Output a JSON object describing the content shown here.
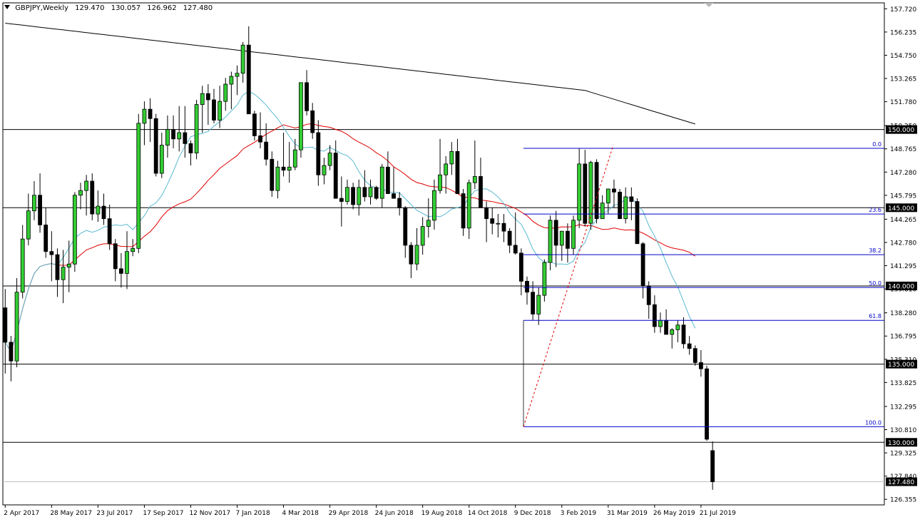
{
  "header": {
    "symbol": "GBPJPY,Weekly",
    "ohlc": [
      "129.470",
      "130.057",
      "126.962",
      "127.480"
    ]
  },
  "chart_data": {
    "type": "candlestick",
    "symbol": "GBPJPY",
    "timeframe": "Weekly",
    "ylim": [
      126.0,
      158.1
    ],
    "y_ticks": [
      "157.720",
      "156.235",
      "154.750",
      "153.265",
      "151.780",
      "150.250",
      "148.765",
      "147.280",
      "145.795",
      "144.265",
      "142.780",
      "141.295",
      "139.810",
      "138.280",
      "136.795",
      "135.310",
      "133.825",
      "132.295",
      "130.810",
      "129.325",
      "127.840",
      "126.355"
    ],
    "x_labels": [
      "2 Apr 2017",
      "28 May 2017",
      "23 Jul 2017",
      "17 Sep 2017",
      "12 Nov 2017",
      "7 Jan 2018",
      "4 Mar 2018",
      "29 Apr 2018",
      "24 Jun 2018",
      "19 Aug 2018",
      "14 Oct 2018",
      "9 Dec 2018",
      "3 Feb 2019",
      "31 Mar 2019",
      "26 May 2019",
      "21 Jul 2019"
    ],
    "candles": [
      [
        138.6,
        139.8,
        134.4,
        136.4
      ],
      [
        136.4,
        136.8,
        133.9,
        135.2
      ],
      [
        135.2,
        140.5,
        134.8,
        139.6
      ],
      [
        139.6,
        143.9,
        139.2,
        143.0
      ],
      [
        143.0,
        145.9,
        142.6,
        144.8
      ],
      [
        144.8,
        146.7,
        144.2,
        145.8
      ],
      [
        145.8,
        147.2,
        143.4,
        143.9
      ],
      [
        143.9,
        145.0,
        141.8,
        142.2
      ],
      [
        142.2,
        143.5,
        140.3,
        142.0
      ],
      [
        142.0,
        142.4,
        139.3,
        140.4
      ],
      [
        140.4,
        142.3,
        138.9,
        141.2
      ],
      [
        141.2,
        142.9,
        139.6,
        141.4
      ],
      [
        141.4,
        146.0,
        140.9,
        145.8
      ],
      [
        145.8,
        146.6,
        144.9,
        146.1
      ],
      [
        146.1,
        147.1,
        144.5,
        146.7
      ],
      [
        146.7,
        147.2,
        144.2,
        144.6
      ],
      [
        144.6,
        146.1,
        144.1,
        145.1
      ],
      [
        145.1,
        145.9,
        143.9,
        144.3
      ],
      [
        144.3,
        145.2,
        142.3,
        142.7
      ],
      [
        142.7,
        143.0,
        140.3,
        141.1
      ],
      [
        141.1,
        142.1,
        139.9,
        140.8
      ],
      [
        140.8,
        143.5,
        139.8,
        142.2
      ],
      [
        142.2,
        143.0,
        141.9,
        142.4
      ],
      [
        142.4,
        151.0,
        142.1,
        150.4
      ],
      [
        150.4,
        151.8,
        149.0,
        151.3
      ],
      [
        151.3,
        152.0,
        149.2,
        150.7
      ],
      [
        150.7,
        151.0,
        147.0,
        147.2
      ],
      [
        147.2,
        149.8,
        146.9,
        149.0
      ],
      [
        149.0,
        150.9,
        148.2,
        150.0
      ],
      [
        150.0,
        150.9,
        148.8,
        149.4
      ],
      [
        149.4,
        151.5,
        148.6,
        149.8
      ],
      [
        149.8,
        151.5,
        148.2,
        149.1
      ],
      [
        149.1,
        149.3,
        147.7,
        148.5
      ],
      [
        148.5,
        151.9,
        148.1,
        151.6
      ],
      [
        151.6,
        152.8,
        149.8,
        152.3
      ],
      [
        152.3,
        152.9,
        150.3,
        151.9
      ],
      [
        151.9,
        152.6,
        150.4,
        150.6
      ],
      [
        150.6,
        152.8,
        150.1,
        151.8
      ],
      [
        151.8,
        153.3,
        151.2,
        152.9
      ],
      [
        152.9,
        153.7,
        151.3,
        153.4
      ],
      [
        153.4,
        154.1,
        152.2,
        153.6
      ],
      [
        153.6,
        155.6,
        153.0,
        155.4
      ],
      [
        155.4,
        156.6,
        152.3,
        151.0
      ],
      [
        151.0,
        151.2,
        149.3,
        149.6
      ],
      [
        149.6,
        151.1,
        148.8,
        149.2
      ],
      [
        149.2,
        150.4,
        147.7,
        148.1
      ],
      [
        148.1,
        148.6,
        145.7,
        146.1
      ],
      [
        146.1,
        148.0,
        145.6,
        147.6
      ],
      [
        147.6,
        149.8,
        147.0,
        147.4
      ],
      [
        147.4,
        149.2,
        146.6,
        147.6
      ],
      [
        147.6,
        149.4,
        147.4,
        148.7
      ],
      [
        148.7,
        152.0,
        148.2,
        153.0
      ],
      [
        153.0,
        153.8,
        150.9,
        151.2
      ],
      [
        151.2,
        151.7,
        149.4,
        149.8
      ],
      [
        149.8,
        150.6,
        146.4,
        147.1
      ],
      [
        147.1,
        148.2,
        146.5,
        147.7
      ],
      [
        147.7,
        149.0,
        147.4,
        148.5
      ],
      [
        148.5,
        149.3,
        145.9,
        145.6
      ],
      [
        145.6,
        147.0,
        143.8,
        145.4
      ],
      [
        145.4,
        146.8,
        145.2,
        146.3
      ],
      [
        146.3,
        146.6,
        144.9,
        145.2
      ],
      [
        145.2,
        146.8,
        144.5,
        146.3
      ],
      [
        146.3,
        147.4,
        145.4,
        145.7
      ],
      [
        145.7,
        146.8,
        145.2,
        146.3
      ],
      [
        146.3,
        146.4,
        145.5,
        145.6
      ],
      [
        145.6,
        147.8,
        145.0,
        147.6
      ],
      [
        147.6,
        148.6,
        146.8,
        145.9
      ],
      [
        145.9,
        147.6,
        145.6,
        145.6
      ],
      [
        145.6,
        146.0,
        144.5,
        145.0
      ],
      [
        145.0,
        145.1,
        141.8,
        142.6
      ],
      [
        142.6,
        142.8,
        140.5,
        141.4
      ],
      [
        141.4,
        143.7,
        141.0,
        142.6
      ],
      [
        142.6,
        144.4,
        142.0,
        143.8
      ],
      [
        143.8,
        145.6,
        143.1,
        144.2
      ],
      [
        144.2,
        146.8,
        143.6,
        146.1
      ],
      [
        146.1,
        149.4,
        145.9,
        147.1
      ],
      [
        147.1,
        148.3,
        145.9,
        147.8
      ],
      [
        147.8,
        149.2,
        147.1,
        148.6
      ],
      [
        148.6,
        149.4,
        146.2,
        145.9
      ],
      [
        145.9,
        146.2,
        143.2,
        143.7
      ],
      [
        143.7,
        146.8,
        143.0,
        146.6
      ],
      [
        146.6,
        149.3,
        146.2,
        147.0
      ],
      [
        147.0,
        148.2,
        145.6,
        145.0
      ],
      [
        145.0,
        145.4,
        142.8,
        144.3
      ],
      [
        144.3,
        145.0,
        143.3,
        144.0
      ],
      [
        144.0,
        144.6,
        143.1,
        144.0
      ],
      [
        144.0,
        144.6,
        142.8,
        143.5
      ],
      [
        143.5,
        143.7,
        142.1,
        142.6
      ],
      [
        142.6,
        144.7,
        142.0,
        142.1
      ],
      [
        142.1,
        142.4,
        139.4,
        140.3
      ],
      [
        140.3,
        140.6,
        138.8,
        139.6
      ],
      [
        139.6,
        140.3,
        137.8,
        138.2
      ],
      [
        138.2,
        139.9,
        137.5,
        139.4
      ],
      [
        139.4,
        141.7,
        139.0,
        141.5
      ],
      [
        141.5,
        144.5,
        141.0,
        144.2
      ],
      [
        144.2,
        144.8,
        141.2,
        142.6
      ],
      [
        142.6,
        143.5,
        141.6,
        143.5
      ],
      [
        143.5,
        144.0,
        141.5,
        142.4
      ],
      [
        142.4,
        144.5,
        142.0,
        144.2
      ],
      [
        144.2,
        148.8,
        143.7,
        147.8
      ],
      [
        147.8,
        148.7,
        143.8,
        144.0
      ],
      [
        144.0,
        148.0,
        143.6,
        147.9
      ],
      [
        147.9,
        148.1,
        144.0,
        144.3
      ],
      [
        144.3,
        145.8,
        144.4,
        145.3
      ],
      [
        145.3,
        146.1,
        144.6,
        146.2
      ],
      [
        146.2,
        146.8,
        145.0,
        146.0
      ],
      [
        146.0,
        146.2,
        144.3,
        144.3
      ],
      [
        144.3,
        146.3,
        144.0,
        145.7
      ],
      [
        145.7,
        146.3,
        144.2,
        145.4
      ],
      [
        145.4,
        145.6,
        144.1,
        142.7
      ],
      [
        142.7,
        142.8,
        139.2,
        140.0
      ],
      [
        140.0,
        140.3,
        137.9,
        138.8
      ],
      [
        138.8,
        139.4,
        137.0,
        137.4
      ],
      [
        137.4,
        138.3,
        137.0,
        137.8
      ],
      [
        137.8,
        138.5,
        136.9,
        136.9
      ],
      [
        136.9,
        137.3,
        136.0,
        137.2
      ],
      [
        137.2,
        137.8,
        136.4,
        137.5
      ],
      [
        137.5,
        138.0,
        136.0,
        136.3
      ],
      [
        136.3,
        136.8,
        135.6,
        136.0
      ],
      [
        136.0,
        136.2,
        134.9,
        135.1
      ],
      [
        135.1,
        135.9,
        134.2,
        134.7
      ],
      [
        134.7,
        134.9,
        130.1,
        130.2
      ],
      [
        129.47,
        130.057,
        126.962,
        127.48
      ]
    ],
    "sma_black_label": "",
    "horizontal_levels": [
      "150.000",
      "145.000",
      "140.000",
      "135.000",
      "130.000"
    ],
    "current_price": "127.480",
    "fibonacci": {
      "high": 148.8,
      "low": 131.0,
      "levels": [
        {
          "label": "0.0",
          "price": 148.8
        },
        {
          "label": "23.6",
          "price": 144.6
        },
        {
          "label": "38.2",
          "price": 142.0
        },
        {
          "label": "50.0",
          "price": 139.9
        },
        {
          "label": "61.8",
          "price": 137.8
        },
        {
          "label": "100.0",
          "price": 131.0
        }
      ]
    },
    "colors": {
      "bull": "#32cd32",
      "bear": "#000000",
      "ma_slow": "#000000",
      "ma_mid": "#e00000",
      "ma_fast": "#5ab9d2",
      "fib": "#0000c8",
      "fib_trend": "#e00000",
      "level_line": "#000000"
    }
  }
}
